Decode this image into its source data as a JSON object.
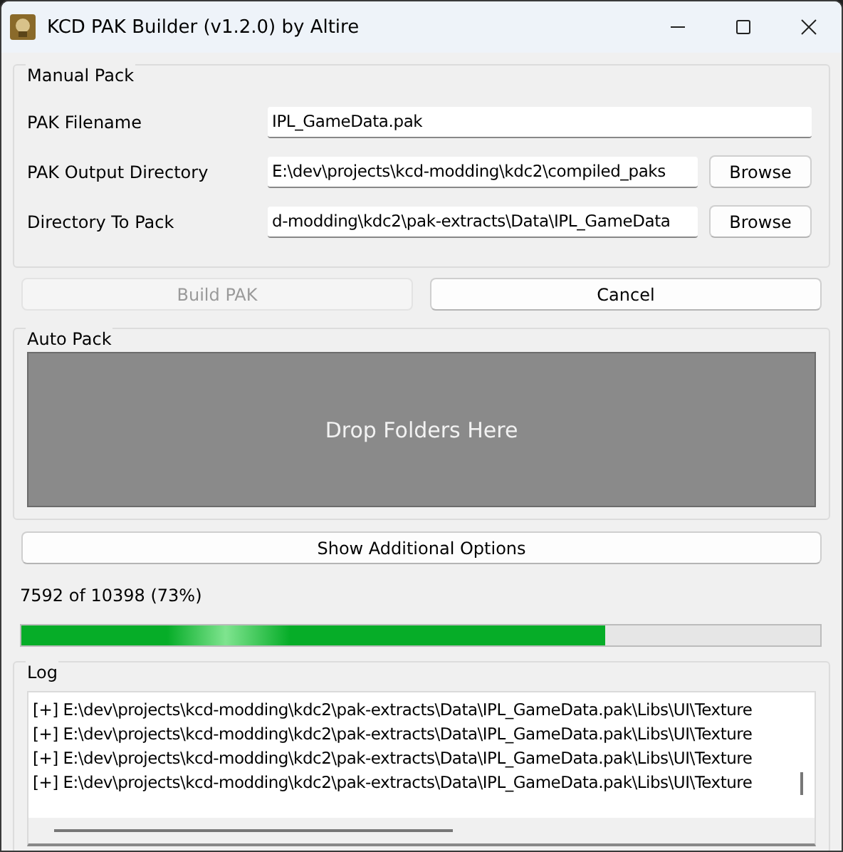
{
  "window": {
    "title": "KCD PAK Builder (v1.2.0) by Altire"
  },
  "manual_pack": {
    "title": "Manual Pack",
    "fields": [
      {
        "label": "PAK Filename",
        "value": "IPL_GameData.pak"
      },
      {
        "label": "PAK Output Directory",
        "value": "E:\\dev\\projects\\kcd-modding\\kdc2\\compiled_paks",
        "button": "Browse"
      },
      {
        "label": "Directory To Pack",
        "value": "d-modding\\kdc2\\pak-extracts\\Data\\IPL_GameData",
        "button": "Browse"
      }
    ]
  },
  "actions": [
    {
      "label": "Build PAK",
      "disabled": true
    },
    {
      "label": "Cancel",
      "disabled": false
    }
  ],
  "auto_pack": {
    "title": "Auto Pack",
    "drop_zone": "Drop Folders Here"
  },
  "options_button": "Show Additional Options",
  "progress": {
    "text": "7592 of 10398 (73%)",
    "level": 0.73
  },
  "log": {
    "title": "Log",
    "lines": [
      "[+] E:\\dev\\projects\\kcd-modding\\kdc2\\pak-extracts\\Data\\IPL_GameData.pak\\Libs\\UI\\Texture",
      "[+] E:\\dev\\projects\\kcd-modding\\kdc2\\pak-extracts\\Data\\IPL_GameData.pak\\Libs\\UI\\Texture",
      "[+] E:\\dev\\projects\\kcd-modding\\kdc2\\pak-extracts\\Data\\IPL_GameData.pak\\Libs\\UI\\Texture",
      "[+] E:\\dev\\projects\\kcd-modding\\kdc2\\pak-extracts\\Data\\IPL_GameData.pak\\Libs\\UI\\Texture"
    ]
  }
}
